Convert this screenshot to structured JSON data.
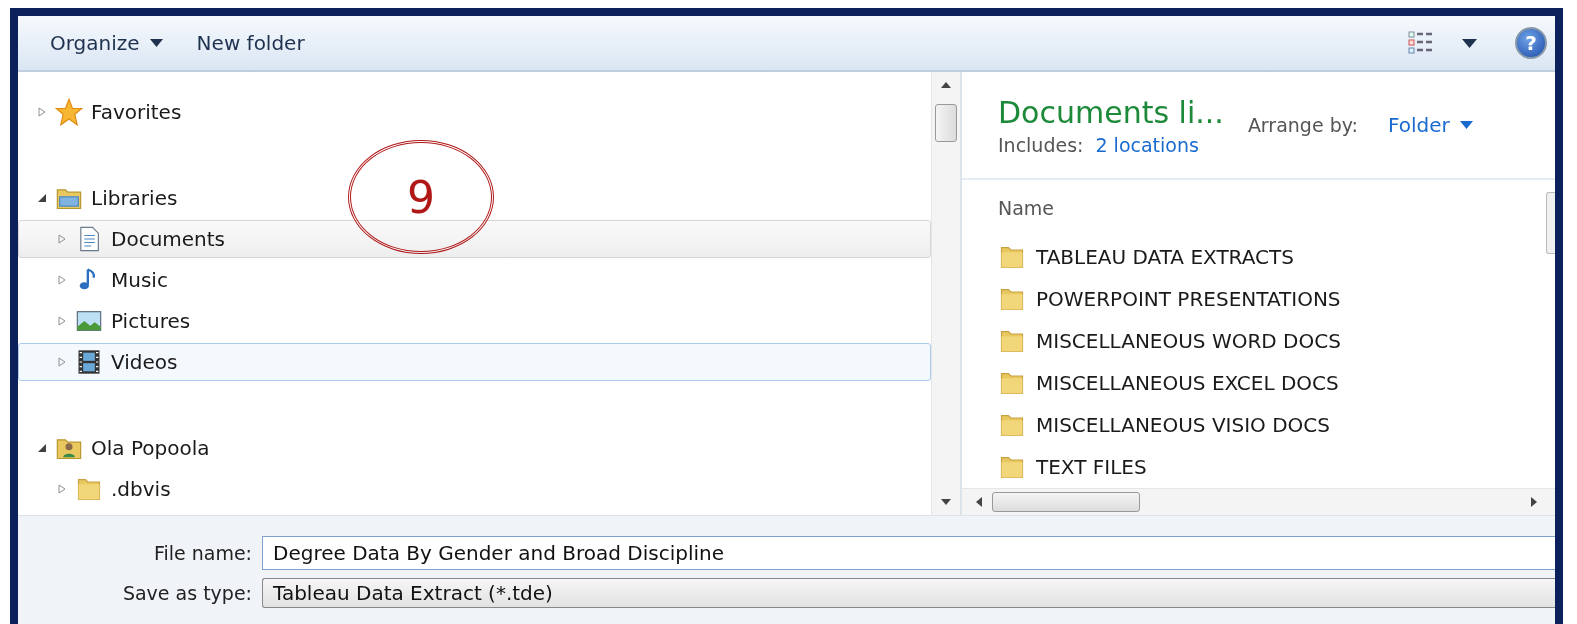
{
  "toolbar": {
    "organize": "Organize",
    "new_folder": "New folder",
    "help": "?"
  },
  "nav_tree": [
    {
      "label": "Favorites",
      "kind": "star",
      "expanded": false,
      "selected": false,
      "highlighted": false
    },
    {
      "label": "Libraries",
      "kind": "library",
      "expanded": true,
      "selected": false,
      "highlighted": false,
      "children": [
        {
          "label": "Documents",
          "kind": "document",
          "expanded": false,
          "selected": false,
          "highlighted": true
        },
        {
          "label": "Music",
          "kind": "music",
          "expanded": false,
          "selected": false,
          "highlighted": false
        },
        {
          "label": "Pictures",
          "kind": "pictures",
          "expanded": false,
          "selected": false,
          "highlighted": false
        },
        {
          "label": "Videos",
          "kind": "videos",
          "expanded": false,
          "selected": true,
          "highlighted": false
        }
      ]
    },
    {
      "label": "Ola Popoola",
      "kind": "user",
      "expanded": true,
      "selected": false,
      "highlighted": false,
      "children": [
        {
          "label": ".dbvis",
          "kind": "folder",
          "expanded": false,
          "selected": false,
          "highlighted": false
        }
      ]
    }
  ],
  "annotation": {
    "text": "9"
  },
  "library": {
    "title": "Documents li...",
    "includes_label": "Includes:",
    "locations_link": "2 locations",
    "arrange_label": "Arrange by:",
    "arrange_value": "Folder"
  },
  "columns": [
    "Name"
  ],
  "files": [
    {
      "name": "TABLEAU DATA EXTRACTS"
    },
    {
      "name": "POWERPOINT PRESENTATIONS"
    },
    {
      "name": "MISCELLANEOUS WORD DOCS"
    },
    {
      "name": "MISCELLANEOUS EXCEL DOCS"
    },
    {
      "name": "MISCELLANEOUS VISIO DOCS"
    },
    {
      "name": "TEXT FILES"
    }
  ],
  "file_name": {
    "label": "File name:",
    "value": "Degree Data By Gender and Broad Discipline"
  },
  "save_type": {
    "label": "Save as type:",
    "value": "Tableau Data Extract (*.tde)"
  }
}
